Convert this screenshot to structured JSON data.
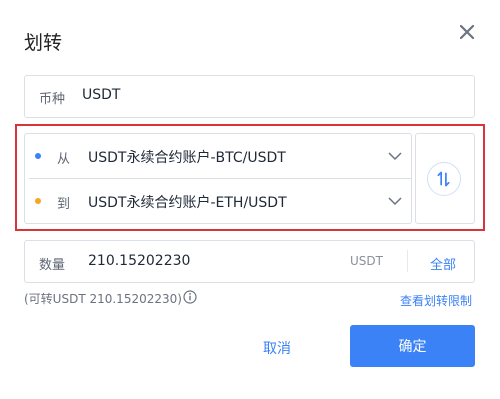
{
  "dialog": {
    "title": "划转"
  },
  "currency": {
    "label": "币种",
    "value": "USDT"
  },
  "from": {
    "label": "从",
    "account": "USDT永续合约账户-BTC/USDT",
    "dot_color": "#3b82f6"
  },
  "to": {
    "label": "到",
    "account": "USDT永续合约账户-ETH/USDT",
    "dot_color": "#f5a623"
  },
  "amount": {
    "label": "数量",
    "value": "210.15202230",
    "unit": "USDT",
    "all_label": "全部"
  },
  "available": {
    "text": "(可转USDT 210.15202230)"
  },
  "limit_link": "查看划转限制",
  "buttons": {
    "cancel": "取消",
    "confirm": "确定"
  },
  "colors": {
    "accent": "#3b82f6",
    "highlight": "#d9343a"
  }
}
